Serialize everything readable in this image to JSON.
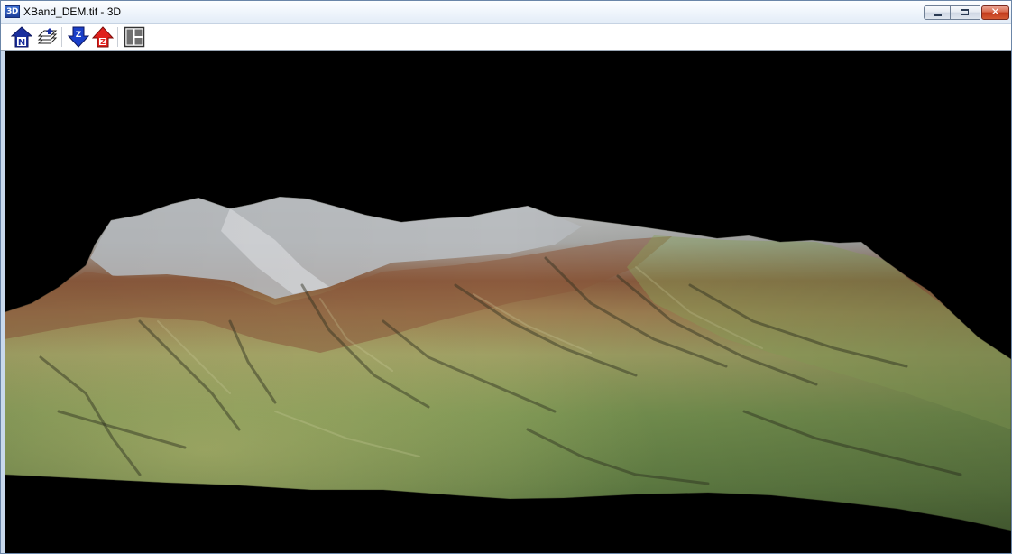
{
  "window": {
    "title": "XBand_DEM.tif - 3D",
    "app_icon_text": "3D",
    "controls": {
      "minimize_icon": "minimize-icon",
      "maximize_icon": "maximize-icon",
      "close_icon": "close-icon",
      "close_glyph": "✕"
    }
  },
  "toolbar": {
    "buttons": [
      {
        "name": "north-up-button",
        "icon": "north-up-icon",
        "letter": "N"
      },
      {
        "name": "layers-button",
        "icon": "layers-icon"
      },
      {
        "name": "z-scale-down-button",
        "icon": "z-down-arrow-icon",
        "letter": "Z"
      },
      {
        "name": "z-scale-up-button",
        "icon": "z-up-arrow-icon",
        "letter": "Z"
      },
      {
        "name": "layout-panels-button",
        "icon": "panels-icon"
      }
    ]
  },
  "viewport": {
    "background": "#000000",
    "terrain_colors": {
      "snow": "#b9bcbf",
      "rock": "#8f5a3a",
      "mid": "#a2a166",
      "low": "#6e8a4e",
      "valley": "#4d6a37"
    }
  }
}
